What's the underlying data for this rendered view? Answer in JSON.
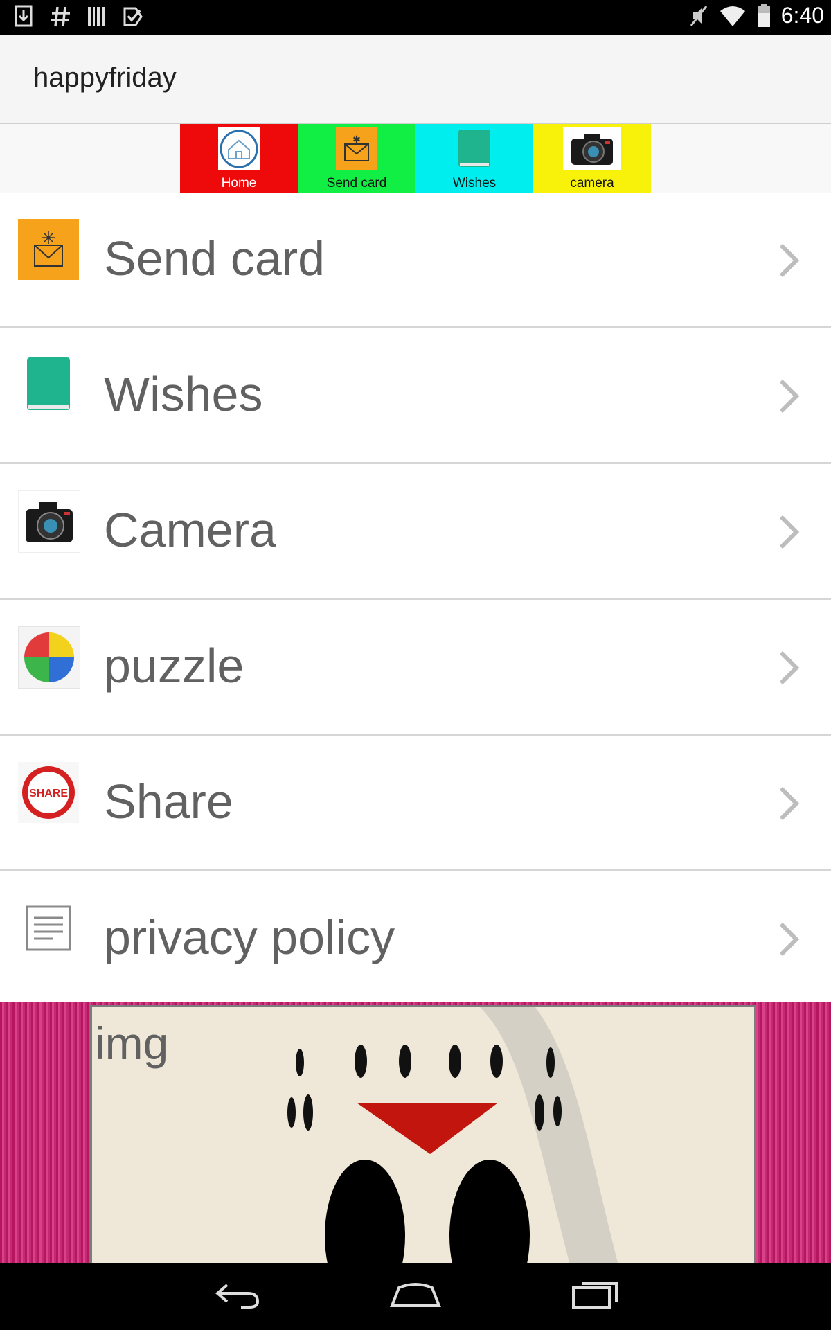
{
  "status_bar": {
    "time": "6:40",
    "left_icons": [
      "download-icon",
      "hash-icon",
      "barcode-icon",
      "checkbox-icon"
    ],
    "right_icons": [
      "mute-icon",
      "wifi-icon",
      "battery-icon"
    ]
  },
  "app_bar": {
    "title": "happyfriday"
  },
  "tabs": [
    {
      "label": "Home",
      "icon": "home-icon",
      "color": "#ee0a0a"
    },
    {
      "label": "Send card",
      "icon": "envelope-icon",
      "color": "#11ee44"
    },
    {
      "label": "Wishes",
      "icon": "book-icon",
      "color": "#00eeee"
    },
    {
      "label": "camera",
      "icon": "camera-icon",
      "color": "#f8f20a"
    }
  ],
  "menu": [
    {
      "label": "Send card",
      "icon": "envelope-icon"
    },
    {
      "label": "Wishes",
      "icon": "book-icon"
    },
    {
      "label": "Camera",
      "icon": "camera-icon"
    },
    {
      "label": "puzzle",
      "icon": "puzzle-icon"
    },
    {
      "label": "Share",
      "icon": "share-icon"
    },
    {
      "label": "privacy policy",
      "icon": "document-icon"
    }
  ],
  "ad": {
    "label": "img"
  },
  "nav_bar": {
    "icons": [
      "back-icon",
      "home-icon",
      "recents-icon"
    ]
  }
}
